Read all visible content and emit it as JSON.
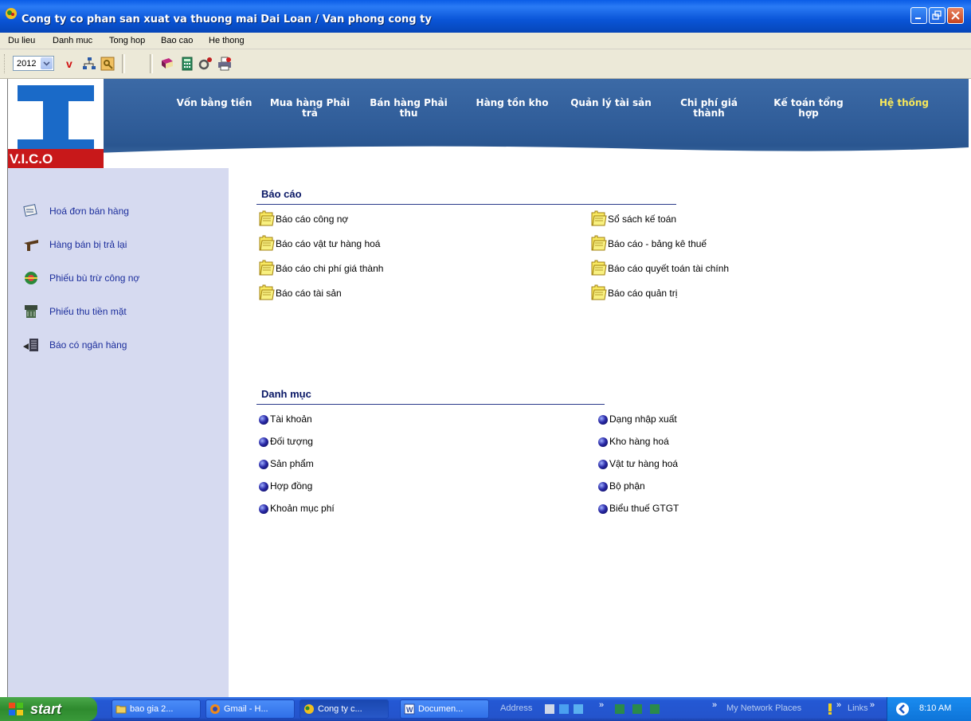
{
  "window": {
    "title": "Cong ty co phan san xuat va thuong mai Dai Loan / Van phong cong ty"
  },
  "menu": [
    "Du lieu",
    "Danh muc",
    "Tong hop",
    "Bao cao",
    "He thong"
  ],
  "toolbar": {
    "year": "2012",
    "icons": [
      "v-icon",
      "network-icon",
      "key-icon",
      "book-icon",
      "calculator-icon",
      "tools-icon",
      "printer-icon"
    ]
  },
  "logo": {
    "text": "V.I.C.O"
  },
  "nav": [
    {
      "label": "Vốn bằng tiền",
      "active": false
    },
    {
      "label": "Mua hàng Phải trả",
      "active": false
    },
    {
      "label": "Bán hàng Phải thu",
      "active": false
    },
    {
      "label": "Hàng tồn kho",
      "active": false
    },
    {
      "label": "Quản lý tài sản",
      "active": false
    },
    {
      "label": "Chi phí giá thành",
      "active": false
    },
    {
      "label": "Kế toán tổng hợp",
      "active": false
    },
    {
      "label": "Hệ thống",
      "active": true
    }
  ],
  "sidebar": [
    {
      "label": "Hoá đơn bán hàng",
      "icon": "invoice-icon"
    },
    {
      "label": "Hàng bán bị trả lại",
      "icon": "return-icon"
    },
    {
      "label": "Phiếu bù trừ công nợ",
      "icon": "offset-icon"
    },
    {
      "label": "Phiếu thu tiền mặt",
      "icon": "cash-receipt-icon"
    },
    {
      "label": "Báo có ngân hàng",
      "icon": "bank-credit-icon"
    }
  ],
  "reports": {
    "title": "Báo cáo",
    "left": [
      "Báo cáo công nợ",
      "Báo cáo vật tư hàng hoá",
      "Báo cáo chi phí giá thành",
      "Báo cáo tài sản"
    ],
    "right": [
      "Sổ sách kế toán",
      "Báo cáo - bảng kê thuế",
      "Báo cáo quyết toán tài chính",
      "Báo cáo quản trị"
    ]
  },
  "catalog": {
    "title": "Danh mục",
    "left": [
      "Tài khoản",
      "Đối tượng",
      "Sản phẩm",
      "Hợp đồng",
      "Khoản mục phí"
    ],
    "right": [
      "Dạng nhập xuất",
      "Kho hàng hoá",
      "Vật tư hàng hoá",
      "Bộ phận",
      "Biểu thuế GTGT"
    ]
  },
  "taskbar": {
    "start": "start",
    "tasks": [
      {
        "label": "bao gia 2...",
        "active": false
      },
      {
        "label": "Gmail - H...",
        "active": false
      },
      {
        "label": "Cong ty c...",
        "active": true
      },
      {
        "label": "Documen...",
        "active": false
      }
    ],
    "address_label": "Address",
    "network_places": "My Network Places",
    "links": "Links",
    "clock": "8:10 AM"
  },
  "colors": {
    "title_bar": "#0a5ce6",
    "banner": "#3c6aa6",
    "sidebar": "#d6daf0",
    "active_nav": "#f8e85a",
    "link_text": "#1c2e9c"
  }
}
